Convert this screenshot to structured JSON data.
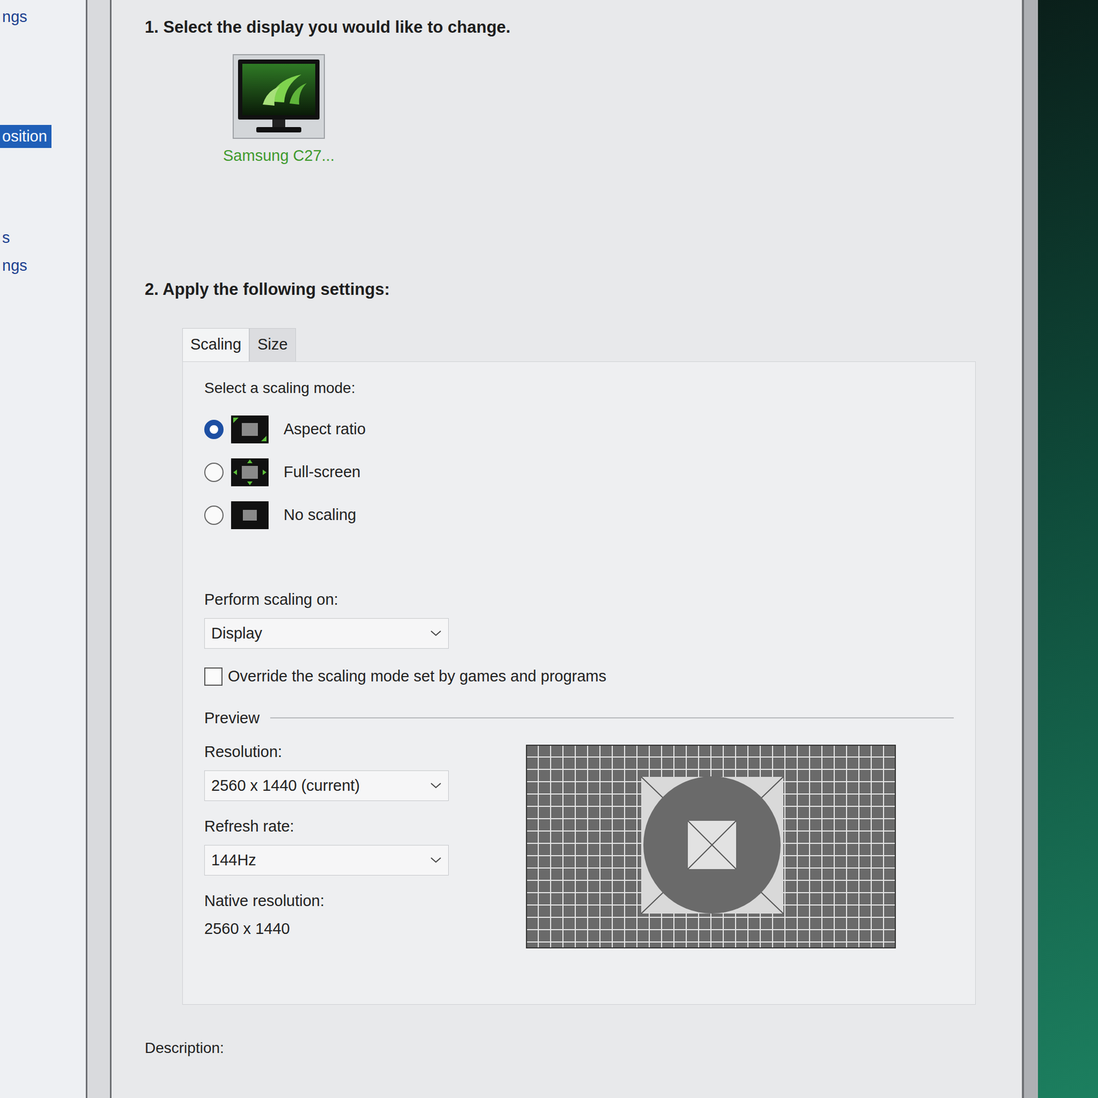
{
  "sidebar": {
    "items": [
      {
        "label": "ngs",
        "selected": false
      },
      {
        "label": "osition",
        "selected": true
      },
      {
        "label": "s",
        "selected": false
      },
      {
        "label": "ngs",
        "selected": false
      }
    ]
  },
  "step1": {
    "heading": "1. Select the display you would like to change.",
    "displays": [
      {
        "label": "Samsung C27...",
        "selected": true
      }
    ]
  },
  "step2": {
    "heading": "2. Apply the following settings:"
  },
  "tabs": [
    {
      "label": "Scaling",
      "selected": true
    },
    {
      "label": "Size",
      "selected": false
    }
  ],
  "scaling": {
    "prompt": "Select a scaling mode:",
    "modes": [
      {
        "label": "Aspect ratio",
        "selected": true
      },
      {
        "label": "Full-screen",
        "selected": false
      },
      {
        "label": "No scaling",
        "selected": false
      }
    ],
    "perform_label": "Perform scaling on:",
    "perform_value": "Display",
    "override": {
      "label": "Override the scaling mode set by games and programs",
      "checked": false
    }
  },
  "preview": {
    "title": "Preview",
    "resolution_label": "Resolution:",
    "resolution_value": "2560 x 1440 (current)",
    "refresh_label": "Refresh rate:",
    "refresh_value": "144Hz",
    "native_label": "Native resolution:",
    "native_value": "2560 x 1440"
  },
  "description": {
    "label": "Description:"
  }
}
